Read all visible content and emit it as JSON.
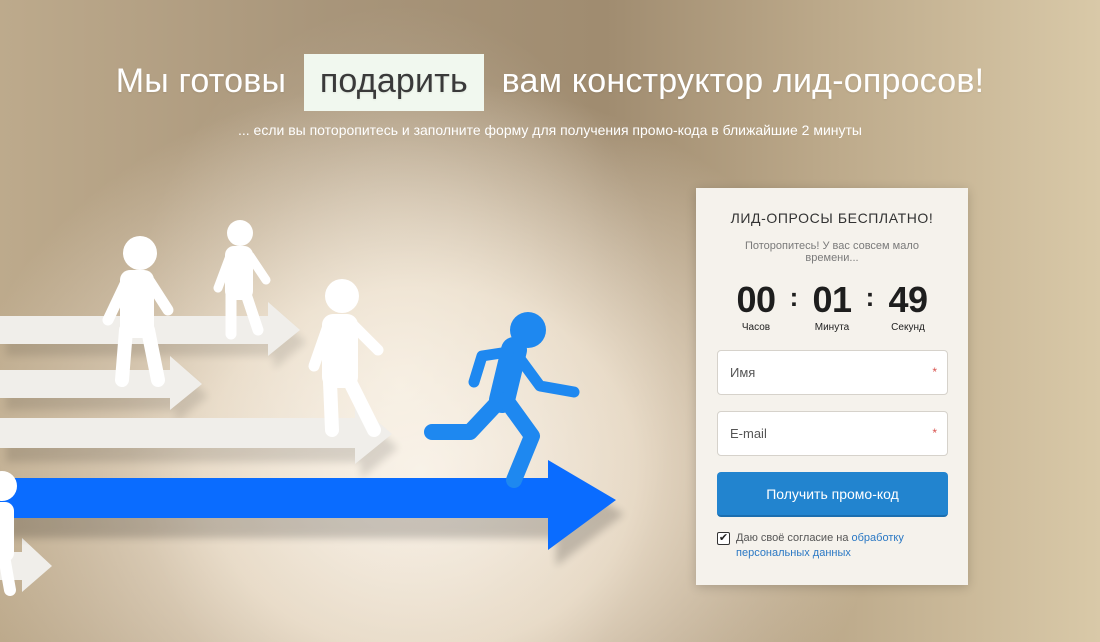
{
  "headline": {
    "before": "Мы готовы",
    "highlight": "подарить",
    "after": "вам конструктор лид-опросов!"
  },
  "subline": "... если вы поторопитесь и заполните форму для получения промо-кода в ближайшие 2 минуты",
  "form": {
    "title": "ЛИД-ОПРОСЫ БЕСПЛАТНО!",
    "subtitle": "Поторопитесь! У вас совсем мало времени...",
    "timer": {
      "hours": "00",
      "hours_label": "Часов",
      "minutes": "01",
      "minutes_label": "Минута",
      "seconds": "49",
      "seconds_label": "Секунд",
      "separator": ":"
    },
    "name_placeholder": "Имя",
    "email_placeholder": "E-mail",
    "required_mark": "*",
    "submit_label": "Получить промо-код",
    "consent_text": "Даю своё согласие на",
    "consent_link": "обработку персональных данных",
    "consent_checked": true,
    "check_mark": "✔"
  },
  "colors": {
    "accent": "#2284cf",
    "runner_blue": "#1e88f0",
    "arrow_blue": "#0a6cff",
    "highlight_bg": "#f1f8ef"
  }
}
